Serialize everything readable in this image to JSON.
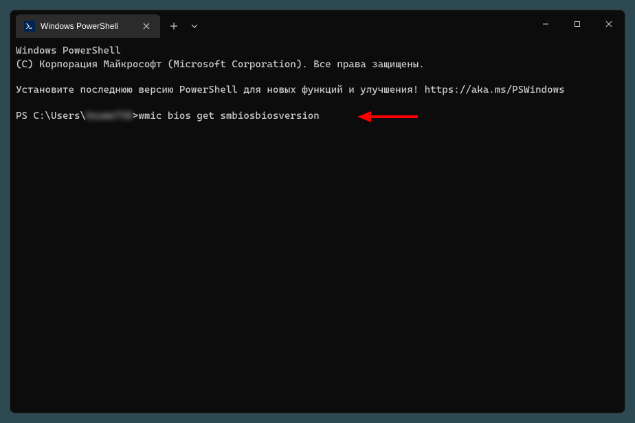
{
  "tab": {
    "title": "Windows PowerShell"
  },
  "terminal": {
    "line1": "Windows PowerShell",
    "line2": "(C) Корпорация Майкрософт (Microsoft Corporation). Все права защищены.",
    "line3": "Установите последнюю версию PowerShell для новых функций и улучшения! https://aka.ms/PSWindows",
    "prompt_prefix": "PS C:\\Users\\",
    "prompt_user_hidden": "Ksome730",
    "prompt_suffix": "> ",
    "command": "wmic bios get smbiosbiosversion"
  },
  "annotation": {
    "color": "#ff0000"
  }
}
